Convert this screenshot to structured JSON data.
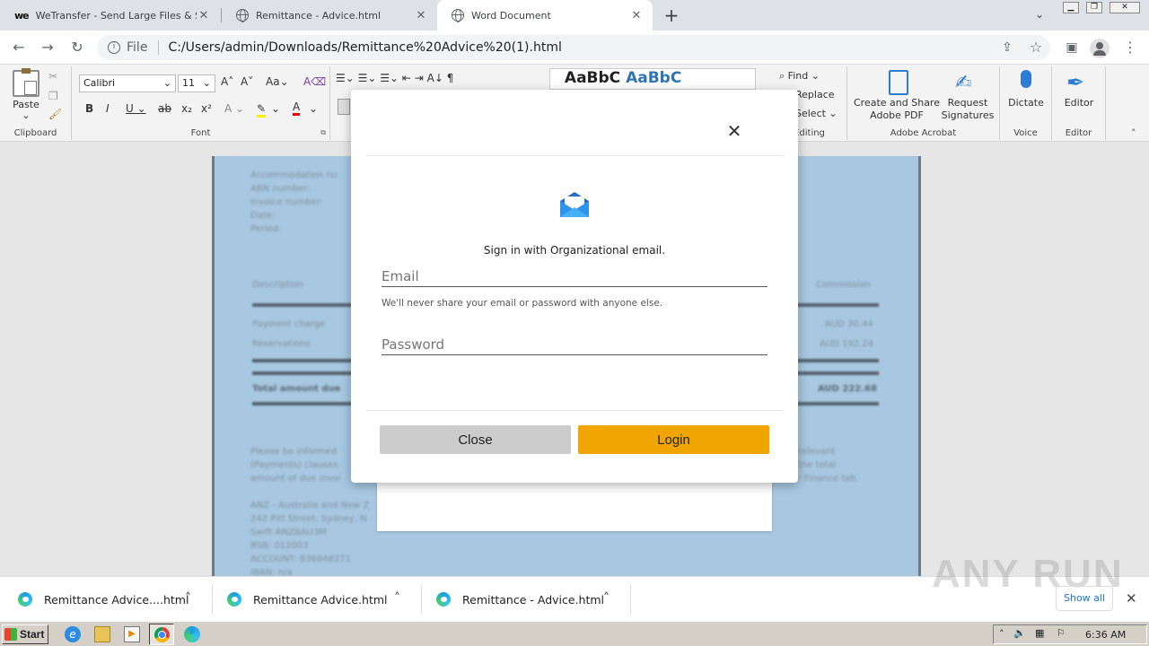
{
  "browser": {
    "tabs": [
      {
        "title": "WeTransfer - Send Large Files & Sha",
        "icon": "wetransfer-icon"
      },
      {
        "title": "Remittance - Advice.html",
        "icon": "globe-icon"
      },
      {
        "title": "Word Document",
        "icon": "globe-icon",
        "active": true
      }
    ],
    "file_label": "File",
    "url": "C:/Users/admin/Downloads/Remittance%20Advice%20(1).html"
  },
  "ribbon": {
    "clipboard": {
      "paste": "Paste",
      "label": "Clipboard"
    },
    "font": {
      "family": "Calibri",
      "size": "11",
      "label": "Font"
    },
    "editing": {
      "find": "Find",
      "replace": "Replace",
      "select": "Select",
      "label": "Editing"
    },
    "acrobat": {
      "create": "Create and Share",
      "create2": "Adobe PDF",
      "request": "Request",
      "request2": "Signatures",
      "label": "Adobe Acrobat"
    },
    "voice": {
      "dictate": "Dictate",
      "label": "Voice"
    },
    "editor": {
      "editor": "Editor",
      "label": "Editor"
    }
  },
  "document": {
    "lines": [
      "Accommodation nu",
      "ABN number:",
      "Invoice number:",
      "Date:",
      "Period:"
    ],
    "col_desc": "Description",
    "col_comm": "Commission",
    "row1": "Payment charge",
    "row1_val": "AUD 30.44",
    "row2": "Reservations",
    "row2_val": "AUD 192.24",
    "total": "Total amount due",
    "total_val": "AUD 222.68",
    "para1": "Please be informed",
    "para2": "(Payments) clauses",
    "para3": "amount of due invoi",
    "para_r1": "relevant",
    "para_r2": "the total",
    "para_r3": "- Finance tab.",
    "bank": [
      "ANZ - Australia and New Z",
      "242 Pitt Street, Sydney, N",
      "Swift ANZBAU3M",
      "BSB: 012003",
      "ACCOUNT: 836848271",
      "IBAN: n/a"
    ]
  },
  "modal": {
    "signin_text": "Sign in with Organizational email.",
    "email_placeholder": "Email",
    "hint": "We'll never share your email or password with anyone else.",
    "password_placeholder": "Password",
    "close_label": "Close",
    "login_label": "Login",
    "login_color": "#f0a500",
    "close_color": "#cccccc"
  },
  "downloads": {
    "items": [
      "Remittance Advice....html",
      "Remittance Advice.html",
      "Remittance - Advice.html"
    ],
    "show_all": "Show all"
  },
  "taskbar": {
    "start": "Start",
    "clock": "6:36 AM"
  },
  "watermark": "ANY RUN"
}
